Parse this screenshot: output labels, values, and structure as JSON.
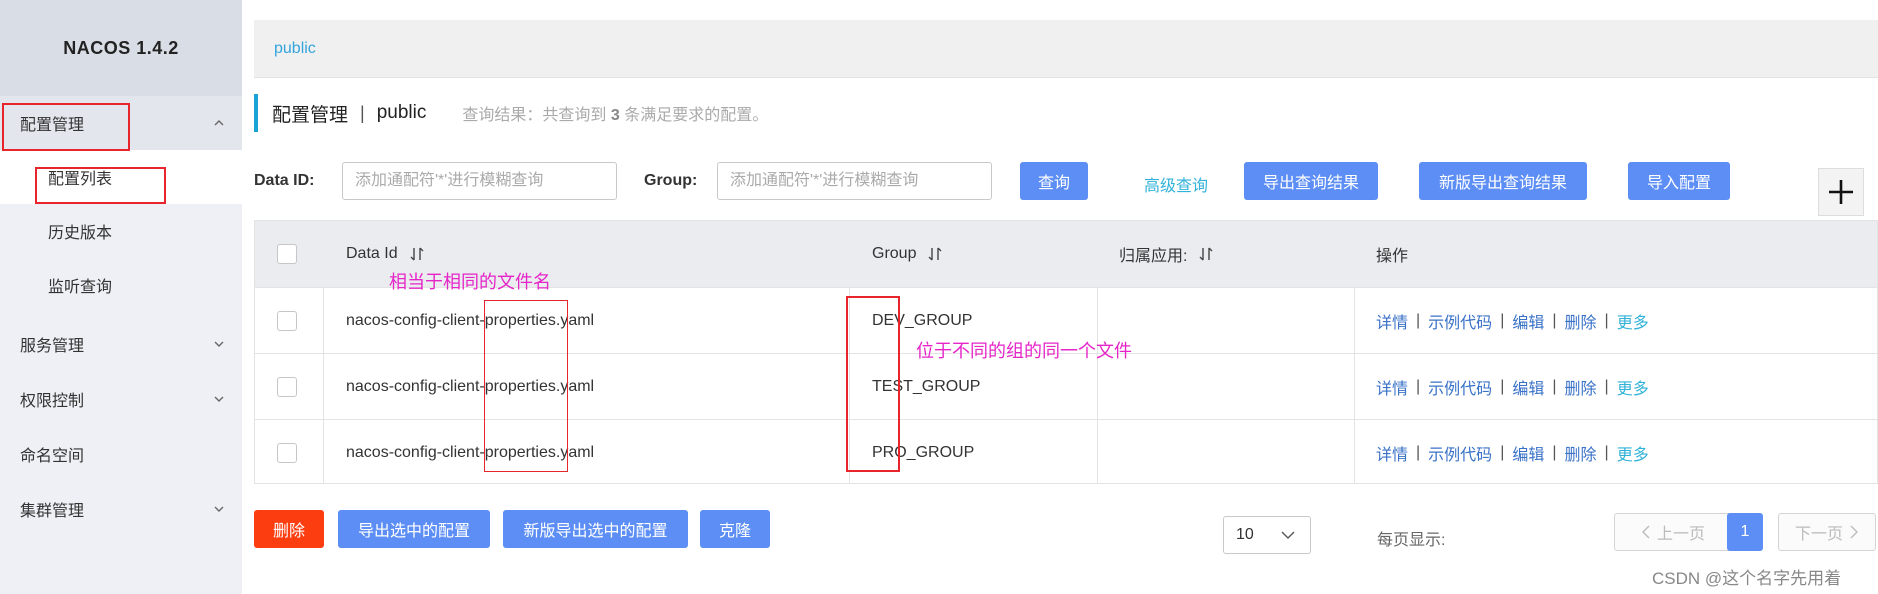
{
  "sidebar": {
    "brand": "NACOS 1.4.2",
    "items": [
      {
        "label": "配置管理"
      },
      {
        "label": "配置列表"
      },
      {
        "label": "历史版本"
      },
      {
        "label": "监听查询"
      },
      {
        "label": "服务管理"
      },
      {
        "label": "权限控制"
      },
      {
        "label": "命名空间"
      },
      {
        "label": "集群管理"
      }
    ]
  },
  "namespace_bar": {
    "current": "public"
  },
  "header": {
    "title": "配置管理",
    "separator": "|",
    "namespace": "public",
    "result_prefix": "查询结果：共查询到",
    "result_count": "3",
    "result_suffix": "条满足要求的配置。"
  },
  "filters": {
    "data_id_label": "Data ID:",
    "data_id_placeholder": "添加通配符'*'进行模糊查询",
    "group_label": "Group:",
    "group_placeholder": "添加通配符'*'进行模糊查询",
    "query_button": "查询",
    "advanced_query": "高级查询",
    "export_results": "导出查询结果",
    "new_export_results": "新版导出查询结果",
    "import_config": "导入配置",
    "add_symbol": "+"
  },
  "table": {
    "columns": [
      "Data Id",
      "Group",
      "归属应用:",
      "操作"
    ],
    "rows": [
      {
        "data_id": "nacos-config-client-properties.yaml",
        "group": "DEV_GROUP",
        "app": ""
      },
      {
        "data_id": "nacos-config-client-properties.yaml",
        "group": "TEST_GROUP",
        "app": ""
      },
      {
        "data_id": "nacos-config-client-properties.yaml",
        "group": "PRO_GROUP",
        "app": ""
      }
    ],
    "actions": {
      "detail": "详情",
      "sample": "示例代码",
      "edit": "编辑",
      "delete": "删除",
      "more": "更多",
      "divider": "|"
    }
  },
  "annotations": {
    "same_filename": "相当于相同的文件名",
    "diff_group": "位于不同的组的同一个文件"
  },
  "footer": {
    "delete": "删除",
    "export_selected": "导出选中的配置",
    "new_export_selected": "新版导出选中的配置",
    "clone": "克隆",
    "page_size_label": "每页显示:",
    "page_size": "10",
    "prev": "上一页",
    "page": "1",
    "next": "下一页"
  },
  "watermark": "CSDN @这个名字先用着",
  "colors": {
    "primary": "#5c8ef5",
    "danger": "#fc3d0f",
    "link": "#3972c7",
    "accent": "#32b2d8",
    "annotation": "#e625c8",
    "highlight": "#e8242c"
  }
}
